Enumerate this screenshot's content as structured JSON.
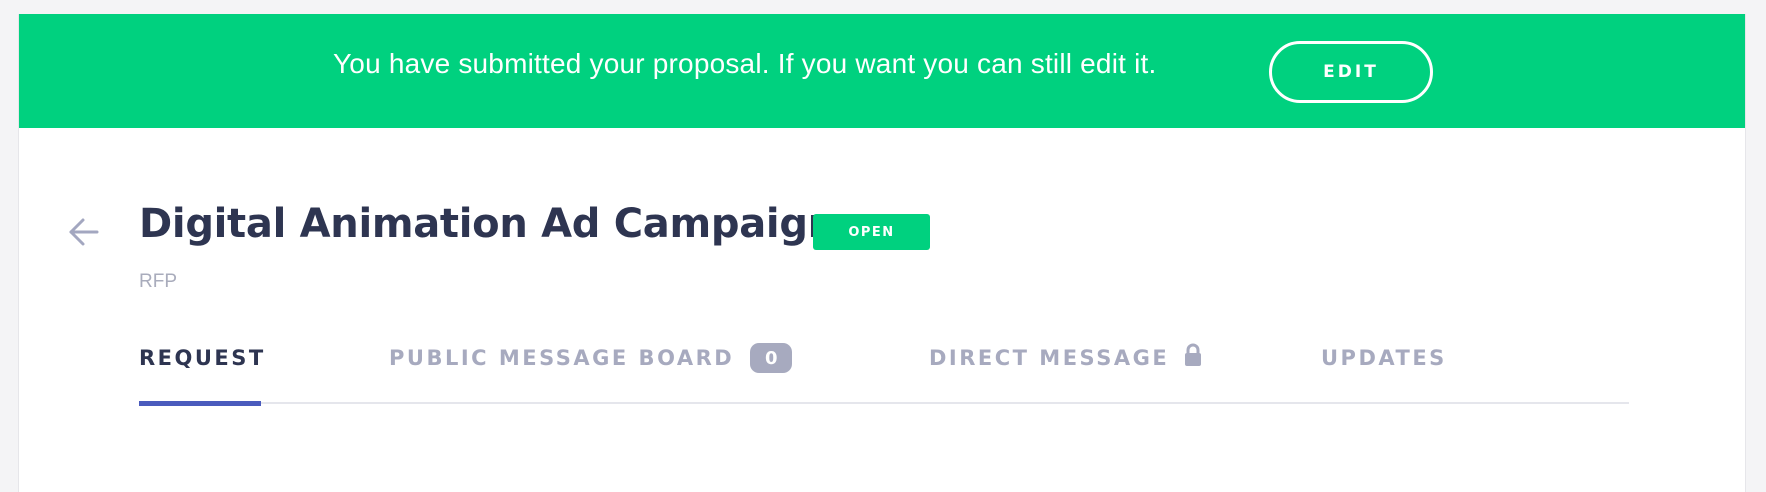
{
  "banner": {
    "message": "You have submitted your proposal. If you want you can still edit it.",
    "edit_label": "EDIT",
    "color": "#00d17f"
  },
  "header": {
    "back_icon": "arrow-left-icon",
    "title": "Digital Animation Ad Campaign",
    "status": "OPEN",
    "subtitle": "RFP"
  },
  "tabs": [
    {
      "label": "REQUEST",
      "active": true
    },
    {
      "label": "PUBLIC MESSAGE BOARD",
      "count": "0"
    },
    {
      "label": "DIRECT MESSAGE",
      "icon": "lock-icon"
    },
    {
      "label": "UPDATES"
    }
  ],
  "colors": {
    "accent": "#4a5bbd",
    "title": "#2e3551",
    "muted": "#a7aabf"
  }
}
